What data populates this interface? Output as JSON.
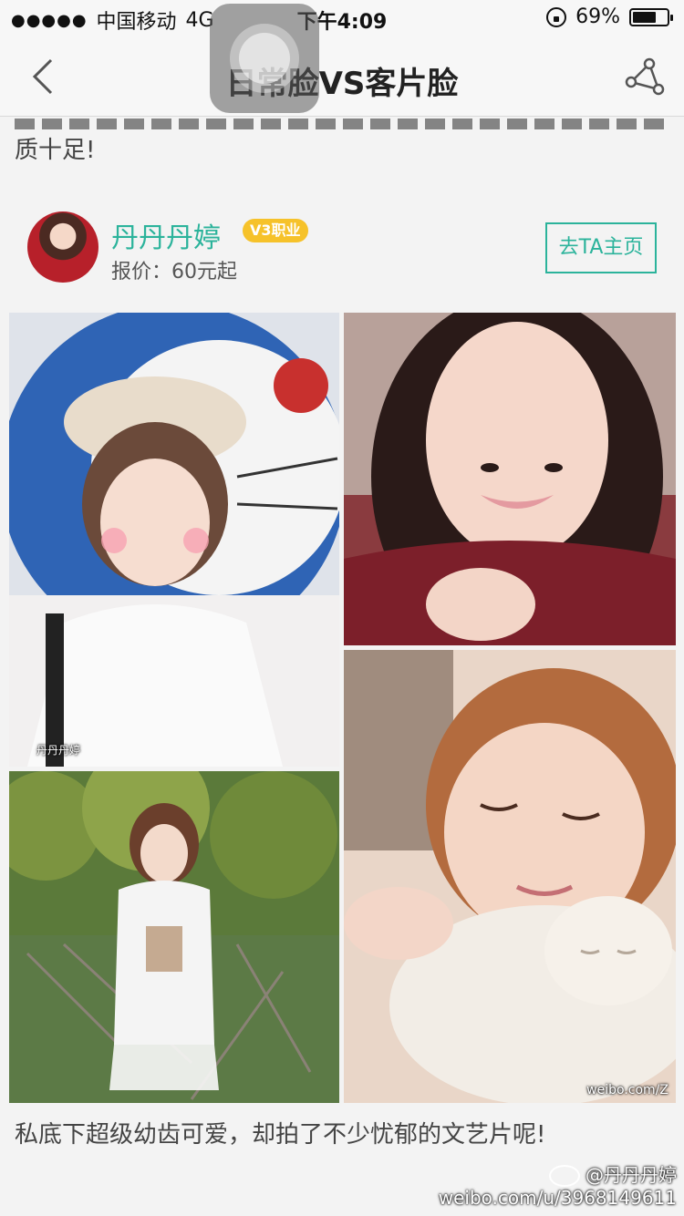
{
  "status_bar": {
    "signal_dots": "●●●●●",
    "carrier": "中国移动",
    "network": "4G",
    "time": "下午4:09",
    "battery_percent": "69%",
    "battery_level": 0.69
  },
  "nav": {
    "title": "日常脸VS客片脸"
  },
  "intro_tail": "质十足!",
  "profile": {
    "name": "丹丹丹婷",
    "badge": "V3职业",
    "price": "报价：60元起",
    "visit_button": "去TA主页"
  },
  "photos": [
    {
      "name": "photo-doraemon-selfie",
      "stamp": "丹丹丹婷"
    },
    {
      "name": "photo-dark-hair-selfie",
      "stamp": ""
    },
    {
      "name": "photo-cat-cuddle",
      "stamp": "weibo.com/Z"
    },
    {
      "name": "photo-garden-portrait",
      "stamp": ""
    }
  ],
  "caption": "私底下超级幼齿可爱，却拍了不少忧郁的文艺片呢!",
  "watermark": {
    "handle": "@丹丹丹婷",
    "url": "weibo.com/u/3968149611"
  },
  "colors": {
    "accent": "#2bb39b",
    "badge": "#f6c22a",
    "background": "#f3f3f3"
  }
}
